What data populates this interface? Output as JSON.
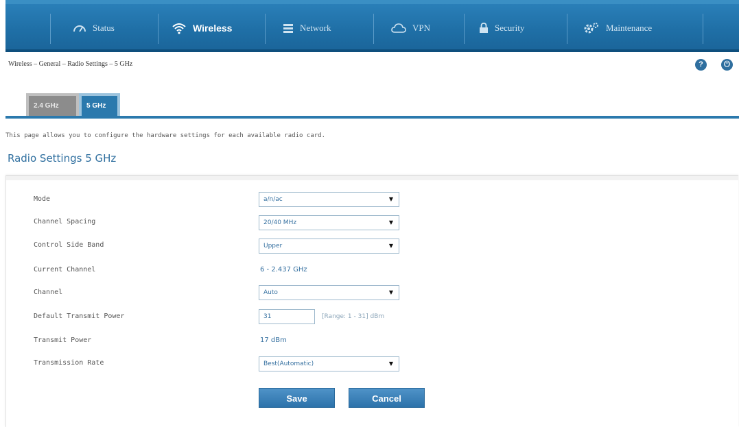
{
  "nav": {
    "items": [
      {
        "label": "Status",
        "icon": "gauge-icon"
      },
      {
        "label": "Wireless",
        "icon": "wifi-icon"
      },
      {
        "label": "Network",
        "icon": "network-icon"
      },
      {
        "label": "VPN",
        "icon": "cloud-icon"
      },
      {
        "label": "Security",
        "icon": "lock-icon"
      },
      {
        "label": "Maintenance",
        "icon": "gears-icon"
      }
    ],
    "active": "Wireless"
  },
  "breadcrumb": {
    "text": "Wireless  –  General  –  Radio Settings  –  5 GHz"
  },
  "tabs": [
    {
      "label": "2.4 GHz"
    },
    {
      "label": "5 GHz"
    }
  ],
  "intro": "This page allows you to configure the hardware settings for each available radio card.",
  "section_title": "Radio Settings 5 GHz",
  "form": {
    "mode": {
      "label": "Mode",
      "value": "a/n/ac"
    },
    "channel_spacing": {
      "label": "Channel Spacing",
      "value": "20/40 MHz"
    },
    "control_side_band": {
      "label": "Control Side Band",
      "value": "Upper"
    },
    "current_channel": {
      "label": "Current Channel",
      "value": "6 - 2.437 GHz"
    },
    "channel": {
      "label": "Channel",
      "value": "Auto"
    },
    "default_transmit_power": {
      "label": "Default Transmit Power",
      "value": "31",
      "hint": "[Range: 1 - 31] dBm"
    },
    "transmit_power": {
      "label": "Transmit Power",
      "value": "17 dBm"
    },
    "transmission_rate": {
      "label": "Transmission Rate",
      "value": "Best(Automatic)"
    }
  },
  "buttons": {
    "save": "Save",
    "cancel": "Cancel"
  },
  "colors": {
    "nav_bg": "#1f6fa6",
    "accent": "#2b79ad",
    "title": "#2f6f9f"
  }
}
